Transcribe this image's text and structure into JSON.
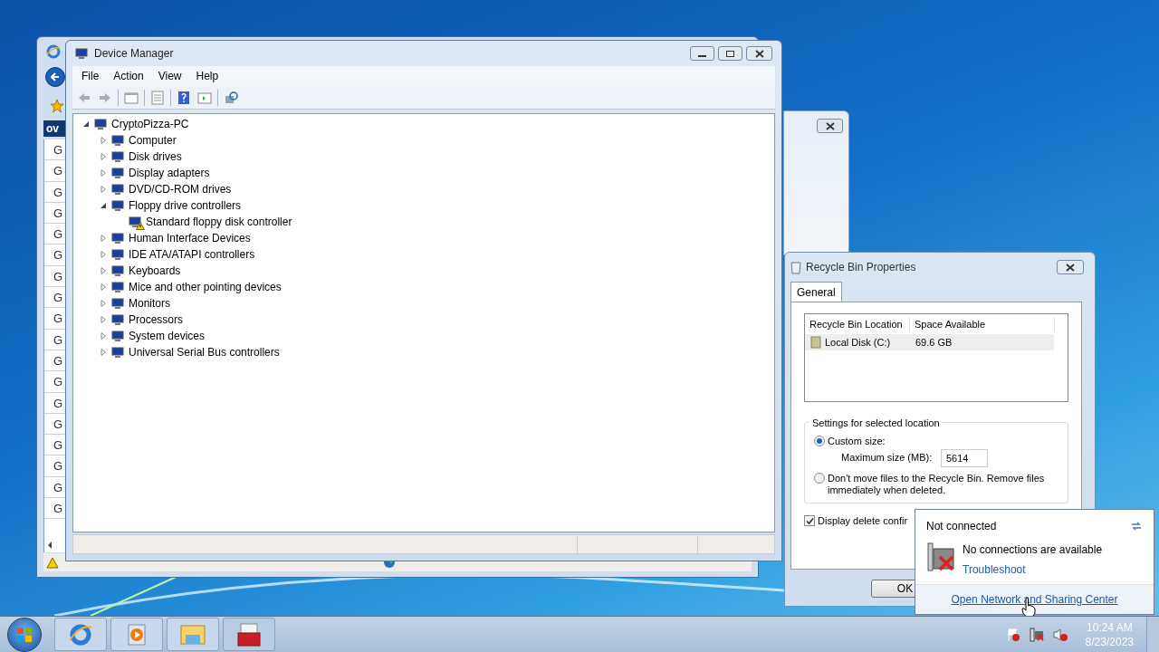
{
  "ie_window": {
    "tab_label": "ov",
    "cells": [
      "G",
      "G",
      "G",
      "G",
      "G",
      "G",
      "G",
      "G",
      "G",
      "G",
      "G",
      "G",
      "G",
      "G",
      "G",
      "G",
      "G",
      "G"
    ]
  },
  "device_manager": {
    "title": "Device Manager",
    "menu": [
      "File",
      "Action",
      "View",
      "Help"
    ],
    "tree": {
      "label": "CryptoPizza-PC",
      "expanded": true,
      "children": [
        {
          "label": "Computer",
          "expanded": false
        },
        {
          "label": "Disk drives",
          "expanded": false
        },
        {
          "label": "Display adapters",
          "expanded": false
        },
        {
          "label": "DVD/CD-ROM drives",
          "expanded": false
        },
        {
          "label": "Floppy drive controllers",
          "expanded": true,
          "children": [
            {
              "label": "Standard floppy disk controller",
              "warning": true
            }
          ]
        },
        {
          "label": "Human Interface Devices",
          "expanded": false
        },
        {
          "label": "IDE ATA/ATAPI controllers",
          "expanded": false
        },
        {
          "label": "Keyboards",
          "expanded": false
        },
        {
          "label": "Mice and other pointing devices",
          "expanded": false
        },
        {
          "label": "Monitors",
          "expanded": false
        },
        {
          "label": "Processors",
          "expanded": false
        },
        {
          "label": "System devices",
          "expanded": false
        },
        {
          "label": "Universal Serial Bus controllers",
          "expanded": false
        }
      ]
    }
  },
  "recycle_bin": {
    "title": "Recycle Bin Properties",
    "tabs": [
      {
        "label": "General",
        "selected": true
      }
    ],
    "columns": [
      "Recycle Bin Location",
      "Space Available"
    ],
    "rows": [
      {
        "location": "Local Disk (C:)",
        "space": "69.6 GB",
        "selected": true
      }
    ],
    "group_title": "Settings for selected location",
    "options": [
      {
        "label": "Custom size:",
        "selected": true
      },
      {
        "label": "Don't move files to the Recycle Bin. Remove files immediately when deleted.",
        "selected": false
      }
    ],
    "max_size_label": "Maximum size (MB):",
    "max_size_value": "5614",
    "confirm": {
      "label": "Display delete confir",
      "checked": true
    },
    "ok_button": "OK"
  },
  "network_popup": {
    "status": "Not connected",
    "message": "No connections are available",
    "link": "Troubleshoot",
    "footer_link": "Open Network and Sharing Center"
  },
  "taskbar": {
    "time": "10:24 AM",
    "date": "8/23/2023"
  }
}
